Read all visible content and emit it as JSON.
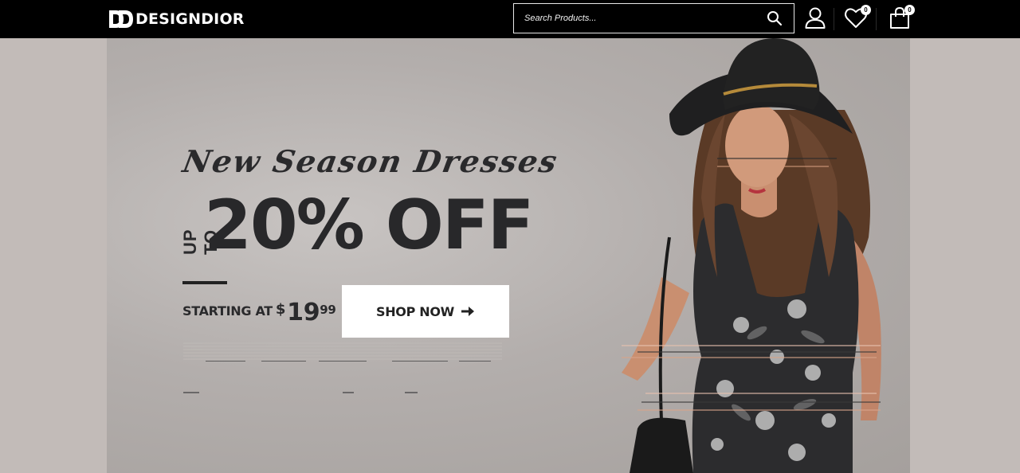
{
  "brand": {
    "name": "DESIGNDIOR"
  },
  "search": {
    "placeholder": "Search Products..."
  },
  "header": {
    "wishlist_count": "0",
    "cart_count": "0"
  },
  "hero": {
    "tagline": "New Season Dresses",
    "up_to": "UP TO",
    "discount": "20% OFF",
    "starting_label": "STARTING AT",
    "price_currency": "$",
    "price_main": "19",
    "price_cents": "99",
    "cta_label": "SHOP NOW"
  },
  "colors": {
    "header_bg": "#000000",
    "hero_bg": "#b3aeac",
    "text_dark": "#28282a",
    "button_bg": "#ffffff"
  },
  "icons": [
    "logo-mark-icon",
    "search-icon",
    "user-icon",
    "heart-icon",
    "shopping-bag-icon",
    "arrow-right-icon"
  ]
}
